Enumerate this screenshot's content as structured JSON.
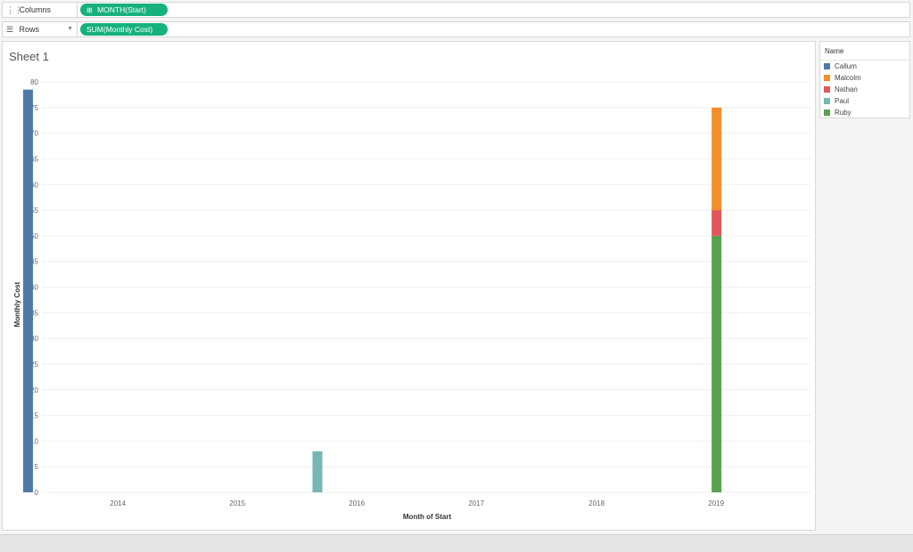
{
  "shelves": {
    "columns": {
      "label": "Columns",
      "icon": "columns-icon",
      "pill": "MONTH(Start)",
      "pill_icon": "plus-box-icon"
    },
    "rows": {
      "label": "Rows",
      "icon": "rows-icon",
      "pill": "SUM(Monthly Cost)"
    }
  },
  "sheet": {
    "title": "Sheet 1"
  },
  "legend": {
    "title": "Name",
    "items": [
      {
        "label": "Callum",
        "color": "#4e79a7"
      },
      {
        "label": "Malcolm",
        "color": "#f28e2b"
      },
      {
        "label": "Nathan",
        "color": "#e15759"
      },
      {
        "label": "Paul",
        "color": "#76b7b2"
      },
      {
        "label": "Ruby",
        "color": "#59a14f"
      }
    ]
  },
  "chart_data": {
    "type": "bar",
    "stacked": true,
    "xlabel": "Month of Start",
    "ylabel": "Monthly Cost",
    "ylim": [
      0,
      80
    ],
    "y_ticks": [
      0,
      5,
      10,
      15,
      20,
      25,
      30,
      35,
      40,
      45,
      50,
      55,
      60,
      65,
      70,
      75,
      80
    ],
    "x_ticks": [
      "2014",
      "2015",
      "2016",
      "2017",
      "2018",
      "2019"
    ],
    "grid": true,
    "legend_position": "right",
    "bars": [
      {
        "month": "2013-10",
        "segments": [
          {
            "name": "Callum",
            "value": 78.5
          }
        ]
      },
      {
        "month": "2016-03",
        "segments": [
          {
            "name": "Paul",
            "value": 8
          }
        ]
      },
      {
        "month": "2019-07",
        "segments": [
          {
            "name": "Ruby",
            "value": 50
          },
          {
            "name": "Nathan",
            "value": 5
          },
          {
            "name": "Malcolm",
            "value": 20
          }
        ]
      }
    ]
  }
}
